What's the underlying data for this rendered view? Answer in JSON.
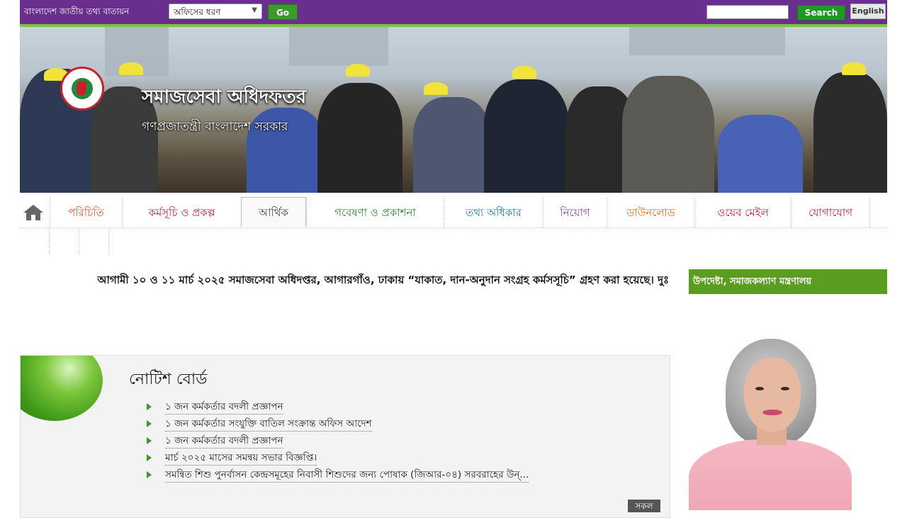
{
  "topbar": {
    "portal_title": "বাংলাদেশ জাতীয় তথ্য বাতায়ন",
    "office_type_select": "অফিসের ধরণ",
    "go_label": "Go",
    "search_label": "Search",
    "language_label": "English"
  },
  "header": {
    "site_name": "সমাজসেবা অধিদফতর",
    "site_subtitle": "গণপ্রজাতন্ত্রী বাংলাদেশ সরকার"
  },
  "nav": {
    "items": [
      {
        "label": "পরিচিতি",
        "color": "#e2562b"
      },
      {
        "label": "কর্মসূচি ও প্রকল্প",
        "color": "#c41e3a"
      },
      {
        "label": "আর্থিক",
        "color": "#444444"
      },
      {
        "label": "গবেষণা ও প্রকাশনা",
        "color": "#2b8a2b"
      },
      {
        "label": "তথ্য অধিকার",
        "color": "#1b7fb5"
      },
      {
        "label": "নিয়োগ",
        "color": "#7a4fb4"
      },
      {
        "label": "ডাউনলোড",
        "color": "#e26d1a"
      },
      {
        "label": "ওয়েব মেইল",
        "color": "#c41e3a"
      },
      {
        "label": "যোগাযোগ",
        "color": "#c41e3a"
      }
    ]
  },
  "ticker": {
    "text": "আগামী ১০ ও ১১ মার্চ ২০২৫ সমাজসেবা অধিদপ্তর, আগারগাঁও, ঢাকায় “যাকাত, দান-অনুদান সংগ্রহ কর্মসসূচি” গ্রহণ করা হয়েছে। দুঃ"
  },
  "notice_board": {
    "title": "নোটিশ বোর্ড",
    "items": [
      "১ জন কর্মকর্তার বদলী প্রজ্ঞাপন",
      "১ জন কর্মকর্তার সংযুক্তি বাতিল সংক্রান্ত অফিস আদেশ",
      "১ জন কর্মকর্তার বদলী প্রজ্ঞাপন",
      "মার্চ ২০২৫ মাসের সমন্বয় সভার বিজ্ঞপ্তি।",
      "সমন্বিত শিশু পুনর্বাসন কেন্দ্রসমূহের নিবাসী শিশুদের জন্য পোষাক (জিআর-০৪) সরবরাহের উন্..."
    ],
    "all_label": "সকল"
  },
  "sidebar": {
    "advisor_heading": "উপদেষ্টা, সমাজকল্যাণ মন্ত্রণালয়"
  },
  "colors": {
    "topbar": "#6a2f8e",
    "accent_green": "#7cc242",
    "advisor_green": "#5b9e1f"
  }
}
